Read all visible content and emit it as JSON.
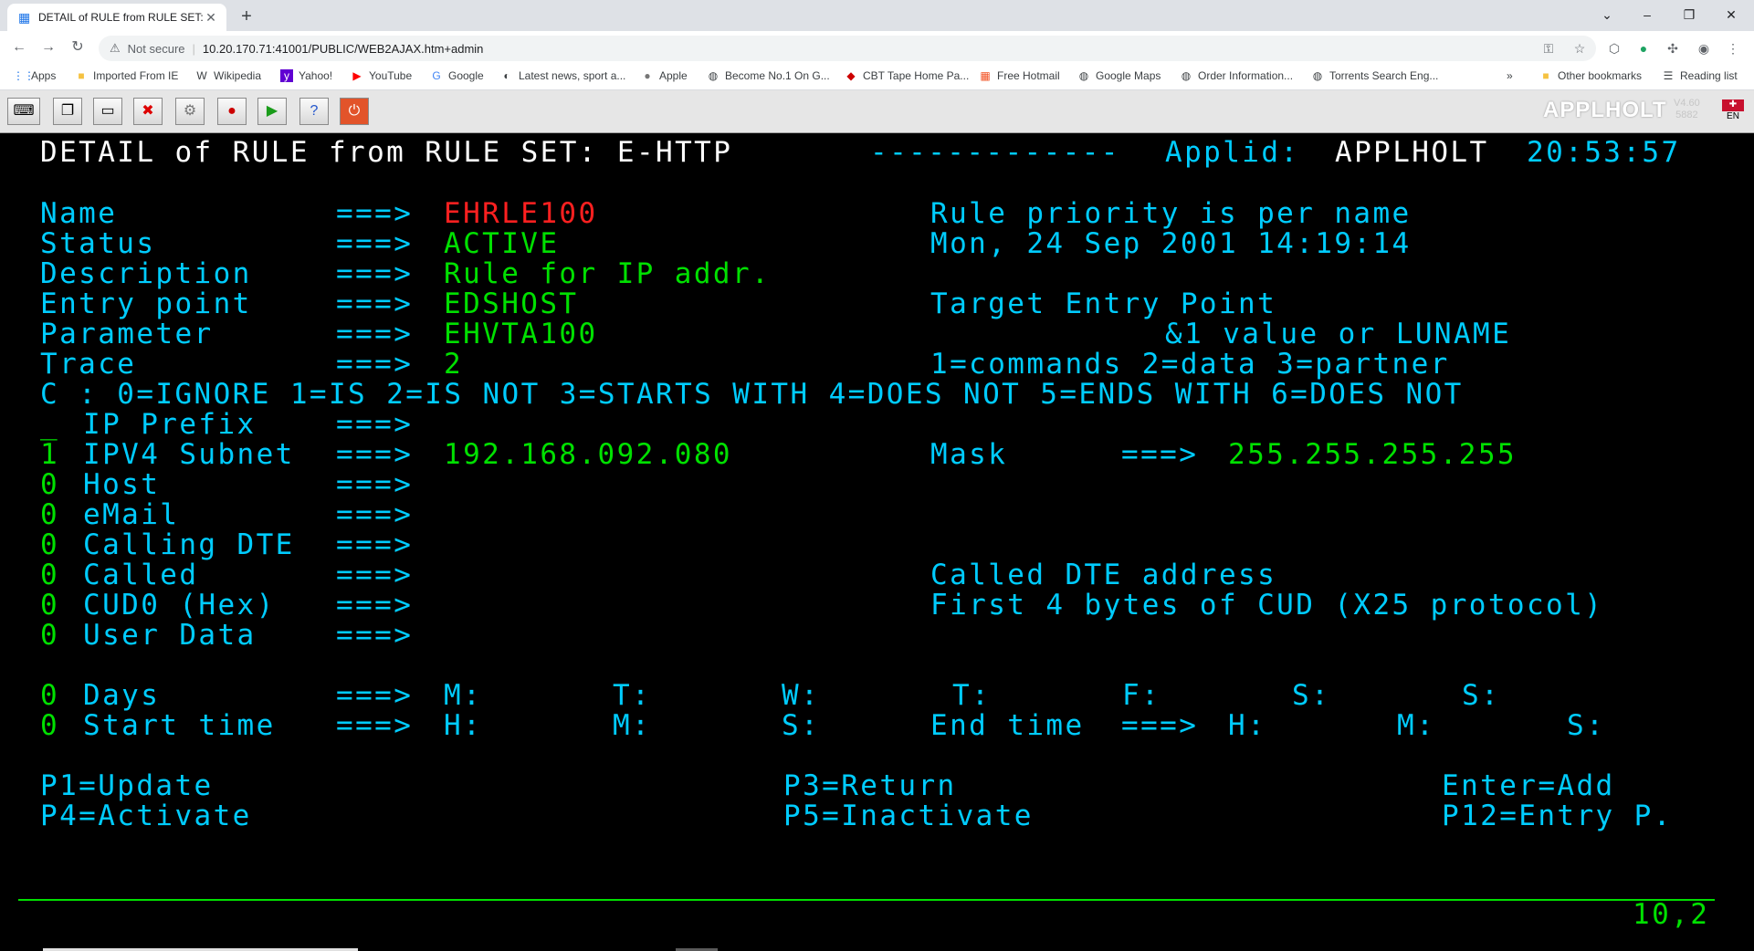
{
  "browser": {
    "tab_title": "DETAIL of RULE from RULE SET: E-HTTP",
    "new_tab": "+",
    "minimize": "–",
    "restore": "❐",
    "close": "✕",
    "not_secure": "Not secure",
    "url": "10.20.170.71:41001/PUBLIC/WEB2AJAX.htm+admin"
  },
  "bookmarks": {
    "items": [
      {
        "label": "Apps",
        "icon": "apps-grid-icon"
      },
      {
        "label": "Imported From IE",
        "icon": "folder-icon"
      },
      {
        "label": "Wikipedia",
        "icon": "wikipedia-icon"
      },
      {
        "label": "Yahoo!",
        "icon": "yahoo-icon"
      },
      {
        "label": "YouTube",
        "icon": "youtube-icon"
      },
      {
        "label": "Google",
        "icon": "google-icon"
      },
      {
        "label": "Latest news, sport a...",
        "icon": "news-icon"
      },
      {
        "label": "Apple",
        "icon": "apple-icon"
      },
      {
        "label": "Become No.1 On G...",
        "icon": "globe-icon"
      },
      {
        "label": "CBT Tape Home Pa...",
        "icon": "tape-icon"
      },
      {
        "label": "Free Hotmail",
        "icon": "windows-icon"
      },
      {
        "label": "Google Maps",
        "icon": "globe-icon"
      },
      {
        "label": "Order Information...",
        "icon": "globe-icon"
      },
      {
        "label": "Torrents Search Eng...",
        "icon": "globe-icon"
      }
    ],
    "overflow": "»",
    "other": "Other bookmarks",
    "reading": "Reading list"
  },
  "emulator": {
    "brand": "APPLHOLT",
    "version_line1": "V4.60",
    "version_line2": "5882",
    "lang": "EN"
  },
  "screen": {
    "title": "DETAIL of RULE from RULE SET: E-HTTP",
    "dashes": "-------------",
    "applid_label": "Applid:",
    "applid": "APPLHOLT",
    "time": "20:53:57",
    "arrow": "===>",
    "fields": {
      "name_label": "Name",
      "name_value": "EHRLE100",
      "status_label": "Status",
      "status_value": "ACTIVE",
      "description_label": "Description",
      "description_value": "Rule for IP addr.",
      "entry_label": "Entry point",
      "entry_value": "EDSHOST",
      "parameter_label": "Parameter",
      "parameter_value": "EHVTA100",
      "trace_label": "Trace",
      "trace_value": "2"
    },
    "right_info": {
      "priority": "Rule priority is per name",
      "date": "Mon, 24 Sep 2001 14:19:14",
      "target": "Target Entry Point",
      "value_or": "&1 value or LUNAME",
      "trace_help": "1=commands 2=data 3=partner"
    },
    "c_legend": "C : 0=IGNORE 1=IS 2=IS NOT 3=STARTS WITH 4=DOES NOT 5=ENDS WITH 6=DOES NOT",
    "conditions": [
      {
        "code": "_",
        "label": "IP Prefix",
        "value": ""
      },
      {
        "code": "1",
        "label": "IPV4 Subnet",
        "value": "192.168.092.080"
      },
      {
        "code": "0",
        "label": "Host",
        "value": ""
      },
      {
        "code": "0",
        "label": "eMail",
        "value": ""
      },
      {
        "code": "0",
        "label": "Calling DTE",
        "value": ""
      },
      {
        "code": "0",
        "label": "Called",
        "value": ""
      },
      {
        "code": "0",
        "label": "CUD0 (Hex)",
        "value": ""
      },
      {
        "code": "0",
        "label": "User Data",
        "value": ""
      }
    ],
    "mask_label": "Mask",
    "mask_value": "255.255.255.255",
    "called_help": "Called DTE address",
    "cud_help": "First 4 bytes of CUD (X25 protocol)",
    "days": {
      "code": "0",
      "label": "Days",
      "m": "M:",
      "t1": "T:",
      "w": "W:",
      "t2": "T:",
      "f": "F:",
      "s1": "S:",
      "s2": "S:"
    },
    "start": {
      "code": "0",
      "label": "Start time",
      "h": "H:",
      "m": "M:",
      "s": "S:",
      "end_label": "End time",
      "eh": "H:",
      "em": "M:",
      "es": "S:"
    },
    "pf": {
      "p1": "P1=Update",
      "p3": "P3=Return",
      "enter": "Enter=Add",
      "p4": "P4=Activate",
      "p5": "P5=Inactivate",
      "p12": "P12=Entry P."
    },
    "cursor": "10,2"
  }
}
